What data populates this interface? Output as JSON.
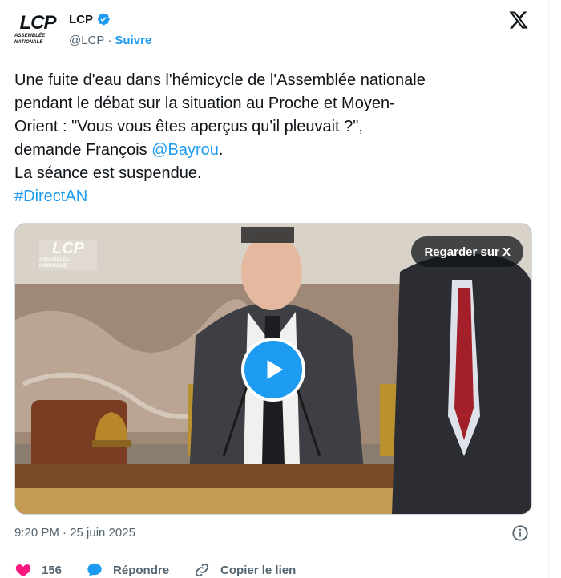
{
  "header": {
    "display_name": "LCP",
    "handle": "@LCP",
    "separator": "·",
    "follow_label": "Suivre",
    "avatar": {
      "logo_main": "LCP",
      "logo_sub": "ASSEMBLÉE NATIONALE"
    },
    "verified_icon": "verified-badge-icon",
    "x_icon": "x-logo-icon"
  },
  "tweet": {
    "line1": "Une fuite d'eau dans l'hémicycle de l'Assemblée nationale",
    "line2": "pendant le débat sur la situation au Proche et Moyen-",
    "line3": "Orient : \"Vous vous êtes aperçus qu'il pleuvait ?\",",
    "line4_prefix": "demande François ",
    "mention": "@Bayrou",
    "line4_suffix": ".",
    "line5": "La séance est suspendue.",
    "hashtag": "#DirectAN"
  },
  "media": {
    "watch_label": "Regarder sur X",
    "play_icon": "play-icon",
    "watermark_main": "LCP",
    "watermark_sub": "ASSEMBLÉE NATIONALE"
  },
  "meta": {
    "timestamp": "9:20 PM · 25 juin 2025",
    "info_icon": "info-icon"
  },
  "actions": {
    "like_count": "156",
    "reply_label": "Répondre",
    "copy_link_label": "Copier le lien"
  },
  "colors": {
    "accent": "#1d9bf0",
    "like": "#f91880",
    "text": "#0f1419",
    "muted": "#536471"
  }
}
